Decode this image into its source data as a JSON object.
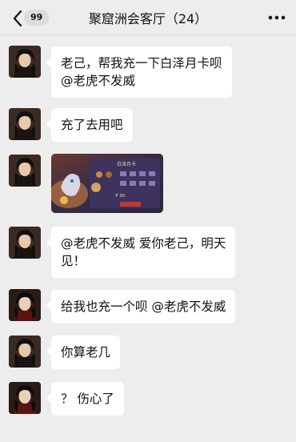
{
  "header": {
    "back_badge": "99",
    "title": "聚窟洲会客厅（24）"
  },
  "messages": [
    {
      "type": "text",
      "text": "老己，帮我充一下白泽月卡呗\n@老虎不发威"
    },
    {
      "type": "text",
      "text": "充了去用吧"
    },
    {
      "type": "image",
      "image_title": "白泽月卡",
      "image_price": "¥ 30"
    },
    {
      "type": "text",
      "text": "@老虎不发威 爱你老己，明天\n见！"
    },
    {
      "type": "text",
      "text": "给我也充一个呗 @老虎不发威"
    },
    {
      "type": "text",
      "text": "你算老几"
    },
    {
      "type": "text",
      "text": "？ 伤心了"
    }
  ],
  "colors": {
    "background": "#ededed",
    "bubble": "#ffffff"
  },
  "icons": {
    "back": "chevron-left-icon",
    "more": "more-dots-icon"
  }
}
